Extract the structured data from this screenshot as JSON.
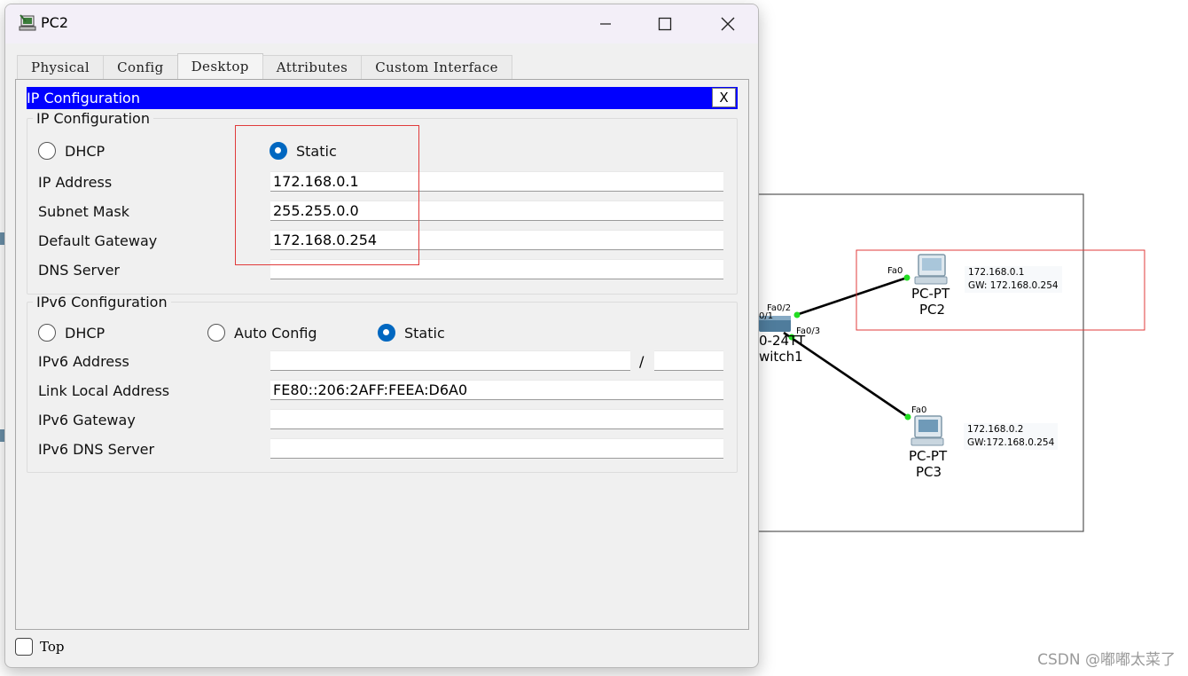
{
  "window": {
    "title": "PC2",
    "tabs": [
      "Physical",
      "Config",
      "Desktop",
      "Attributes",
      "Custom Interface"
    ],
    "active_tab": "Desktop",
    "top_checkbox_label": "Top",
    "top_checked": false
  },
  "ip_config": {
    "panel_title": "IP Configuration",
    "close_label": "X",
    "ipv4": {
      "group_title": "IP Configuration",
      "dhcp_label": "DHCP",
      "static_label": "Static",
      "mode": "Static",
      "ip_address_label": "IP Address",
      "ip_address": "172.168.0.1",
      "subnet_mask_label": "Subnet Mask",
      "subnet_mask": "255.255.0.0",
      "default_gateway_label": "Default Gateway",
      "default_gateway": "172.168.0.254",
      "dns_server_label": "DNS Server",
      "dns_server": ""
    },
    "ipv6": {
      "group_title": "IPv6 Configuration",
      "dhcp_label": "DHCP",
      "auto_label": "Auto Config",
      "static_label": "Static",
      "mode": "Static",
      "address_label": "IPv6 Address",
      "address": "",
      "prefix_separator": "/",
      "prefix": "",
      "link_local_label": "Link Local Address",
      "link_local": "FE80::206:2AFF:FEEA:D6A0",
      "gateway_label": "IPv6 Gateway",
      "gateway": "",
      "dns_label": "IPv6 DNS Server",
      "dns": ""
    }
  },
  "topology": {
    "switch_label_partial_model": "0-24TT",
    "switch_label_partial_name": "witch1",
    "switch_port_a": "Fa0/2",
    "switch_port_b": "Fa0/3",
    "switch_port_c": "0/1",
    "pc2": {
      "type": "PC-PT",
      "name": "PC2",
      "port": "Fa0",
      "ip_note": "172.168.0.1",
      "gw_note": "GW:  172.168.0.254"
    },
    "pc3": {
      "type": "PC-PT",
      "name": "PC3",
      "port": "Fa0",
      "ip_note": "172.168.0.2",
      "gw_note": "GW:172.168.0.254"
    },
    "link_endpoint_color": "#22dd22"
  },
  "watermark": "CSDN @嘟嘟太菜了",
  "colors": {
    "panel_title_bg": "#0000ff",
    "radio_selected": "#0067c0",
    "annotation_red": "#e03b3b"
  }
}
